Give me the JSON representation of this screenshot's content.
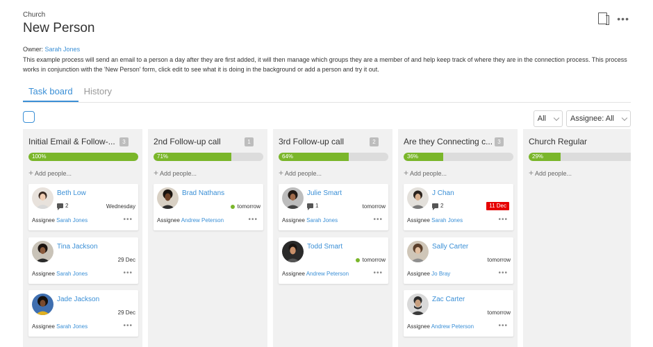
{
  "header": {
    "breadcrumb": "Church",
    "title": "New Person",
    "owner_label": "Owner:",
    "owner_name": "Sarah Jones",
    "description": "This example process will send an email to a person a day after they are first added, it will then manage which groups they are a member of and help keep track of where they are in the connection process. This process works in conjunction with the 'New Person' form, click edit to see what it is doing in the background or add a person and try it out."
  },
  "tabs": {
    "taskboard": "Task board",
    "history": "History"
  },
  "filters": {
    "status": "All",
    "assignee": "Assignee: All"
  },
  "columns": [
    {
      "title": "Initial Email & Follow-...",
      "count": "3",
      "progress_label": "100%",
      "progress": 1.0,
      "add_label": "Add people...",
      "cards": [
        {
          "name": "Beth Low",
          "comments": "2",
          "date": "Wednesday",
          "assignee_label": "Assignee",
          "assignee": "Sarah Jones"
        },
        {
          "name": "Tina Jackson",
          "date": "29 Dec",
          "assignee_label": "Assignee",
          "assignee": "Sarah Jones"
        },
        {
          "name": "Jade Jackson",
          "date": "29 Dec",
          "assignee_label": "Assignee",
          "assignee": "Sarah Jones"
        }
      ]
    },
    {
      "title": "2nd Follow-up call",
      "count": "1",
      "progress_label": "71%",
      "progress": 0.71,
      "add_label": "Add people...",
      "cards": [
        {
          "name": "Brad Nathans",
          "date": "tomorrow",
          "assignee_label": "Assignee",
          "assignee": "Andrew Peterson"
        }
      ]
    },
    {
      "title": "3rd Follow-up call",
      "count": "2",
      "progress_label": "64%",
      "progress": 0.64,
      "add_label": "Add people...",
      "cards": [
        {
          "name": "Julie Smart",
          "comments": "1",
          "date": "tomorrow",
          "assignee_label": "Assignee",
          "assignee": "Sarah Jones"
        },
        {
          "name": "Todd Smart",
          "date": "tomorrow",
          "assignee_label": "Assignee",
          "assignee": "Andrew Peterson"
        }
      ]
    },
    {
      "title": "Are they Connecting c...",
      "count": "3",
      "progress_label": "36%",
      "progress": 0.36,
      "add_label": "Add people...",
      "cards": [
        {
          "name": "J Chan",
          "comments": "2",
          "date": "11 Dec",
          "assignee_label": "Assignee",
          "assignee": "Sarah Jones"
        },
        {
          "name": "Sally Carter",
          "date": "tomorrow",
          "assignee_label": "Assignee",
          "assignee": "Jo Bray"
        },
        {
          "name": "Zac Carter",
          "date": "tomorrow",
          "assignee_label": "Assignee",
          "assignee": "Andrew Peterson"
        }
      ]
    },
    {
      "title": "Church Regular",
      "progress_label": "29%",
      "progress": 0.29,
      "add_label": "Add people..."
    }
  ],
  "colors": {
    "accent": "#3a8fd6",
    "progress": "#7ab62a",
    "overdue": "#e60000"
  }
}
